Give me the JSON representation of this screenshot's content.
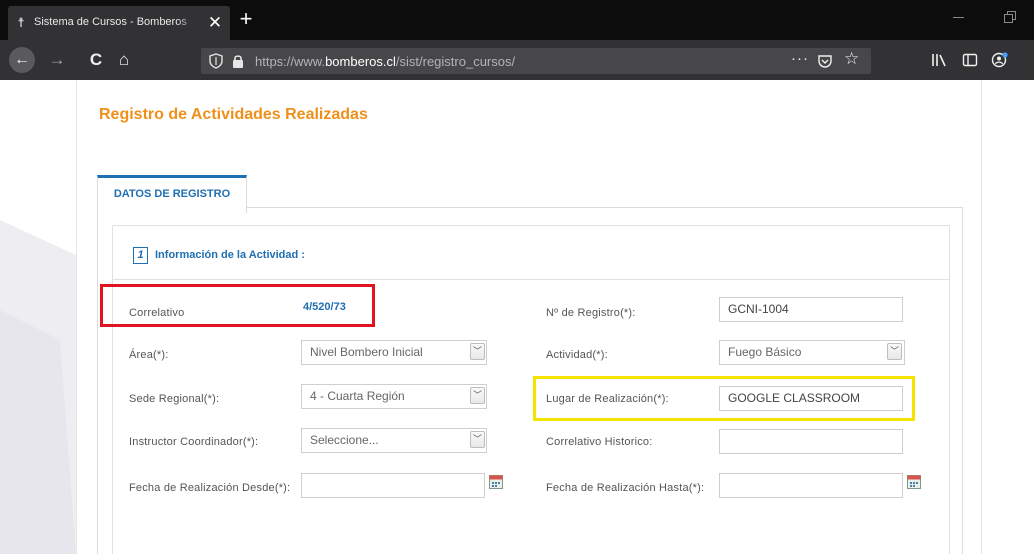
{
  "browser": {
    "tab_title": "Sistema de Cursos - Bomberos",
    "url_prefix": "https://www.",
    "url_domain": "bomberos.cl",
    "url_path": "/sist/registro_cursos/",
    "new_tab_glyph": "+",
    "close_glyph": "✕",
    "page_actions_glyph": "···"
  },
  "page": {
    "title": "Registro de Actividades Realizadas",
    "tab_label": "DATOS DE REGISTRO",
    "section_number": "1",
    "section_title": "Información de la Actividad :"
  },
  "form": {
    "correlativo_label": "Correlativo",
    "correlativo_value": "4/520/73",
    "nro_registro_label": "Nº de Registro(*):",
    "nro_registro_value": "GCNI-1004",
    "area_label": "Área(*):",
    "area_value": "Nivel Bombero Inicial",
    "actividad_label": "Actividad(*):",
    "actividad_value": "Fuego Básico",
    "sede_label": "Sede Regional(*):",
    "sede_value": "4 - Cuarta Región",
    "lugar_label": "Lugar de Realización(*):",
    "lugar_value": "GOOGLE CLASSROOM",
    "instructor_label": "Instructor Coordinador(*):",
    "instructor_value": "Seleccione...",
    "correlativo_historico_label": "Correlativo Historico:",
    "correlativo_historico_value": "",
    "fecha_desde_label": "Fecha de Realización Desde(*):",
    "fecha_desde_value": "",
    "fecha_hasta_label": "Fecha de Realización Hasta(*):",
    "fecha_hasta_value": ""
  },
  "icons": {
    "favicon": "bomberos-emblem-icon",
    "back": "back-arrow-icon",
    "forward": "forward-arrow-icon",
    "reload": "reload-icon",
    "home": "home-icon",
    "shield": "tracking-shield-icon",
    "lock": "lock-icon",
    "pocket": "pocket-icon",
    "star": "bookmark-star-icon",
    "library": "library-icon",
    "sidebar": "sidebar-icon",
    "account": "account-icon",
    "calendar": "calendar-icon"
  },
  "colors": {
    "title_orange": "#f0901c",
    "link_blue": "#1f6fb3",
    "highlight_red": "#e0141e",
    "highlight_yellow": "#f5e400"
  }
}
